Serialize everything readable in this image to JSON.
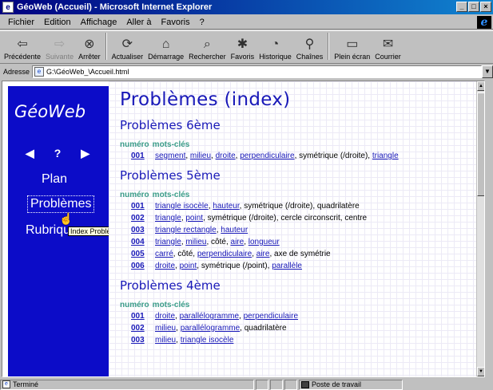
{
  "window": {
    "title": "GéoWeb (Accueil) - Microsoft Internet Explorer",
    "buttons": [
      "_",
      "□",
      "×"
    ]
  },
  "menu": [
    "Fichier",
    "Edition",
    "Affichage",
    "Aller à",
    "Favoris",
    "?"
  ],
  "toolbar": [
    {
      "label": "Précédente",
      "icon": "back-arrow-icon",
      "glyph": "⇦",
      "enabled": true
    },
    {
      "label": "Suivante",
      "icon": "forward-arrow-icon",
      "glyph": "⇨",
      "enabled": false
    },
    {
      "label": "Arrêter",
      "icon": "stop-icon",
      "glyph": "⊗",
      "enabled": true
    },
    {
      "label": "Actualiser",
      "icon": "refresh-icon",
      "glyph": "⟳",
      "enabled": true
    },
    {
      "label": "Démarrage",
      "icon": "home-icon",
      "glyph": "⌂",
      "enabled": true
    },
    {
      "label": "Rechercher",
      "icon": "search-icon",
      "glyph": "⌕",
      "enabled": true
    },
    {
      "label": "Favoris",
      "icon": "favorites-icon",
      "glyph": "✱",
      "enabled": true
    },
    {
      "label": "Historique",
      "icon": "history-icon",
      "glyph": "◔",
      "enabled": true
    },
    {
      "label": "Chaînes",
      "icon": "channels-icon",
      "glyph": "⚲",
      "enabled": true
    },
    {
      "label": "Plein écran",
      "icon": "fullscreen-icon",
      "glyph": "▭",
      "enabled": true
    },
    {
      "label": "Courrier",
      "icon": "mail-icon",
      "glyph": "✉",
      "enabled": true
    }
  ],
  "address": {
    "label": "Adresse",
    "value": "G:\\GéoWeb_\\Accueil.html"
  },
  "sidebar": {
    "title": "GéoWeb",
    "nav": {
      "prev": "◀",
      "help": "?",
      "next": "▶"
    },
    "plan": "Plan",
    "problemes": "Problèmes",
    "rubriques": "Rubriques",
    "tooltip": "Index Problèmes",
    "cursor": "☝"
  },
  "page": {
    "title": "Problèmes (index)",
    "col_num": "numéro",
    "col_kw": "mots-clés",
    "sections": [
      {
        "title": "Problèmes 6ème",
        "rows": [
          {
            "num": "001",
            "kw": [
              {
                "t": "segment",
                "link": true
              },
              {
                "t": ", "
              },
              {
                "t": "milieu",
                "link": true
              },
              {
                "t": ", "
              },
              {
                "t": "droite",
                "link": true
              },
              {
                "t": ", "
              },
              {
                "t": "perpendiculaire",
                "link": true
              },
              {
                "t": ", symétrique (/droite), "
              },
              {
                "t": "triangle",
                "link": true
              }
            ]
          }
        ]
      },
      {
        "title": "Problèmes 5ème",
        "rows": [
          {
            "num": "001",
            "kw": [
              {
                "t": "triangle isocèle",
                "link": true
              },
              {
                "t": ", "
              },
              {
                "t": "hauteur",
                "link": true
              },
              {
                "t": ", symétrique (/droite), quadrilatère"
              }
            ]
          },
          {
            "num": "002",
            "kw": [
              {
                "t": "triangle",
                "link": true
              },
              {
                "t": ", "
              },
              {
                "t": "point",
                "link": true
              },
              {
                "t": ", symétrique (/droite), cercle circonscrit, centre"
              }
            ]
          },
          {
            "num": "003",
            "kw": [
              {
                "t": "triangle rectangle",
                "link": true
              },
              {
                "t": ", "
              },
              {
                "t": "hauteur",
                "link": true
              }
            ]
          },
          {
            "num": "004",
            "kw": [
              {
                "t": "triangle",
                "link": true
              },
              {
                "t": ", "
              },
              {
                "t": "milieu",
                "link": true
              },
              {
                "t": ", côté, "
              },
              {
                "t": "aire",
                "link": true
              },
              {
                "t": ", "
              },
              {
                "t": "longueur",
                "link": true
              }
            ]
          },
          {
            "num": "005",
            "kw": [
              {
                "t": "carré",
                "link": true
              },
              {
                "t": ", côté, "
              },
              {
                "t": "perpendiculaire",
                "link": true
              },
              {
                "t": ", "
              },
              {
                "t": "aire",
                "link": true
              },
              {
                "t": ", axe de symétrie"
              }
            ]
          },
          {
            "num": "006",
            "kw": [
              {
                "t": "droite",
                "link": true
              },
              {
                "t": ", "
              },
              {
                "t": "point",
                "link": true
              },
              {
                "t": ", symétrique (/point), "
              },
              {
                "t": "parallèle",
                "link": true
              }
            ]
          }
        ]
      },
      {
        "title": "Problèmes 4ème",
        "rows": [
          {
            "num": "001",
            "kw": [
              {
                "t": "droite",
                "link": true
              },
              {
                "t": ", "
              },
              {
                "t": "parallélogramme",
                "link": true
              },
              {
                "t": ", "
              },
              {
                "t": "perpendiculaire",
                "link": true
              }
            ]
          },
          {
            "num": "002",
            "kw": [
              {
                "t": "milieu",
                "link": true
              },
              {
                "t": ", "
              },
              {
                "t": "parallélogramme",
                "link": true
              },
              {
                "t": ", quadrilatère"
              }
            ]
          },
          {
            "num": "003",
            "kw": [
              {
                "t": "milieu",
                "link": true
              },
              {
                "t": ", "
              },
              {
                "t": "triangle isocèle",
                "link": true
              }
            ]
          }
        ]
      }
    ]
  },
  "status": {
    "text": "Terminé",
    "zone": "Poste de travail"
  }
}
